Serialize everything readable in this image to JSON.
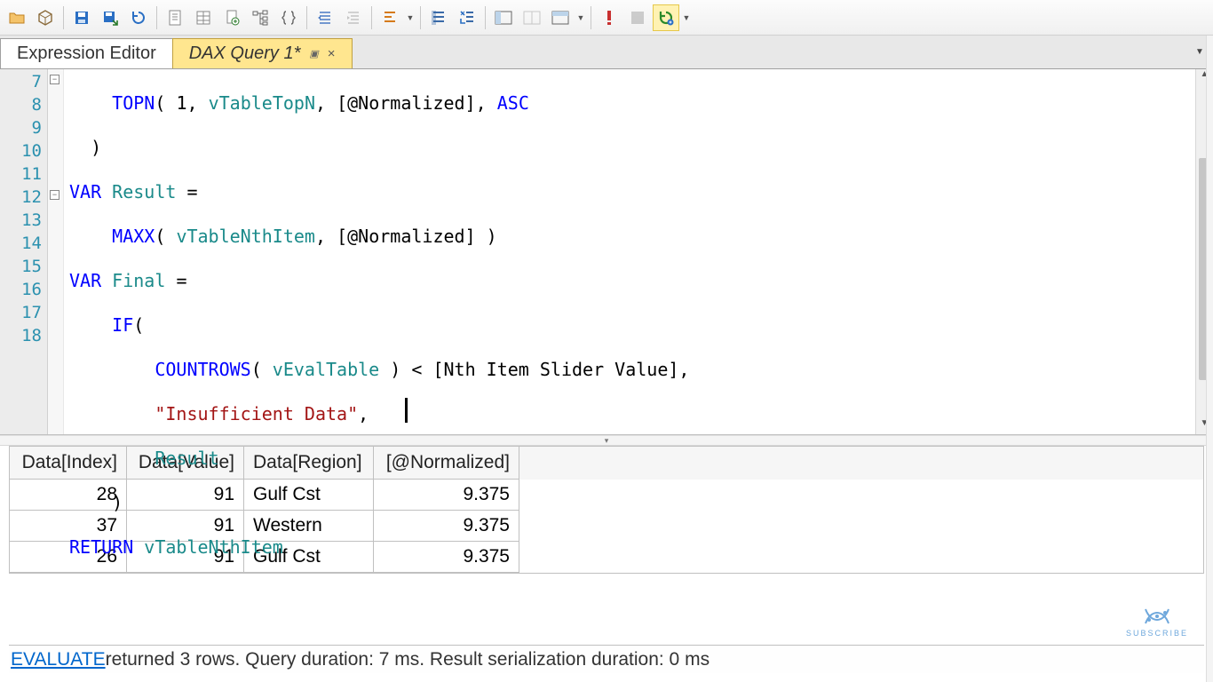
{
  "tabs": {
    "expression_editor": "Expression Editor",
    "dax_query": "DAX Query 1*"
  },
  "code": {
    "lines": [
      "7",
      "8",
      "9",
      "10",
      "11",
      "12",
      "13",
      "14",
      "15",
      "16",
      "17",
      "18"
    ],
    "l7_a": "TOPN",
    "l7_b": "1",
    "l7_c": "vTableTopN",
    "l7_d": "[@Normalized]",
    "l7_e": "ASC",
    "l8": ")",
    "l9_a": "VAR",
    "l9_b": "Result",
    "l10_a": "MAXX",
    "l10_b": "vTableNthItem",
    "l10_c": "[@Normalized]",
    "l11_a": "VAR",
    "l11_b": "Final",
    "l12_a": "IF",
    "l13_a": "COUNTROWS",
    "l13_b": "vEvalTable",
    "l13_c": "[Nth Item Slider Value]",
    "l14": "\"Insufficient Data\"",
    "l15": "Result",
    "l16": ")",
    "l17_a": "RETURN",
    "l17_b": "vTableNthItem"
  },
  "grid": {
    "headers": [
      "Data[Index]",
      "Data[Value]",
      "Data[Region]",
      "[@Normalized]"
    ],
    "rows": [
      {
        "index": "28",
        "value": "91",
        "region": "Gulf Cst",
        "norm": "9.375"
      },
      {
        "index": "37",
        "value": "91",
        "region": "Western",
        "norm": "9.375"
      },
      {
        "index": "26",
        "value": "91",
        "region": "Gulf Cst",
        "norm": "9.375"
      }
    ]
  },
  "status": {
    "link": "EVALUATE",
    "msg_a": " returned 3 rows. Query duration: 7 ms. Result serialization duration: 0 ms"
  },
  "watermark": "SUBSCRIBE"
}
